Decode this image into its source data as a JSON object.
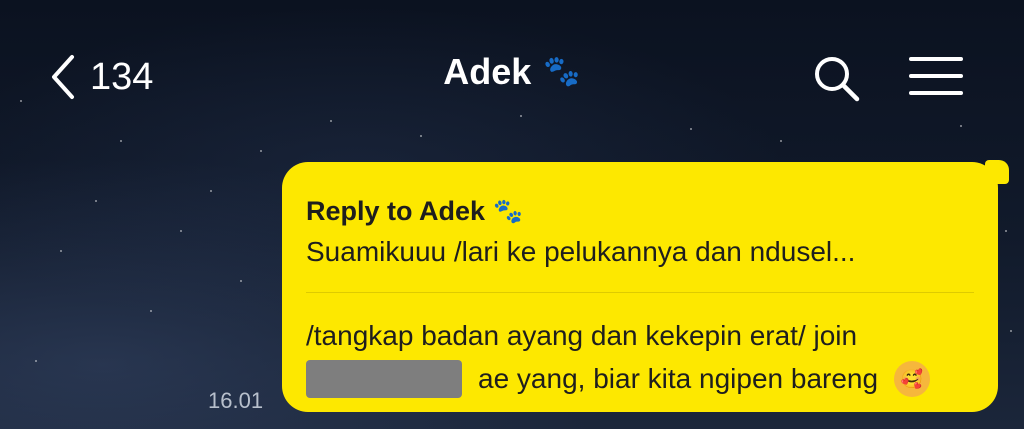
{
  "header": {
    "back_count": "134",
    "title": "Adek",
    "title_emoji": "🐾",
    "icons": [
      "chevron-left-icon",
      "search-icon",
      "menu-icon"
    ]
  },
  "message": {
    "reply_label": "Reply to Adek",
    "reply_emoji": "🐾",
    "reply_preview": "Suamikuuu /lari ke pelukannya dan ndusel...",
    "line1": "/tangkap badan ayang dan kekepin erat/ join",
    "line2_after_redaction": "ae yang, biar kita ngipen bareng",
    "emoji": "🥰",
    "timestamp": "16.01"
  },
  "colors": {
    "bubble": "#fde800",
    "text_dark": "#1e1e1e",
    "header_text": "#ffffff"
  }
}
